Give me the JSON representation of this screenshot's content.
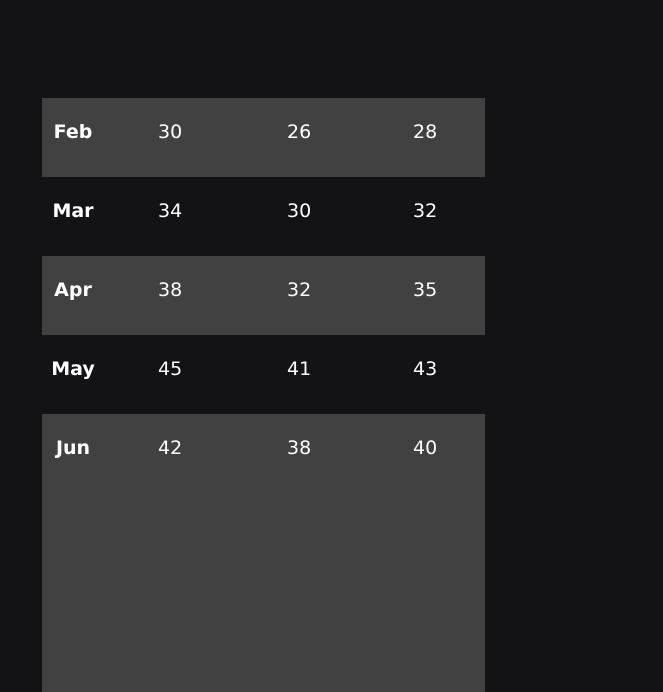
{
  "table": {
    "rows": [
      {
        "month": "Feb",
        "values": [
          "30",
          "26",
          "28"
        ]
      },
      {
        "month": "Mar",
        "values": [
          "34",
          "30",
          "32"
        ]
      },
      {
        "month": "Apr",
        "values": [
          "38",
          "32",
          "35"
        ]
      },
      {
        "month": "May",
        "values": [
          "45",
          "41",
          "43"
        ]
      },
      {
        "month": "Jun",
        "values": [
          "42",
          "38",
          "40"
        ]
      }
    ]
  },
  "colors": {
    "background": "#131316",
    "row_shaded": "#414141",
    "text": "#ffffff"
  }
}
